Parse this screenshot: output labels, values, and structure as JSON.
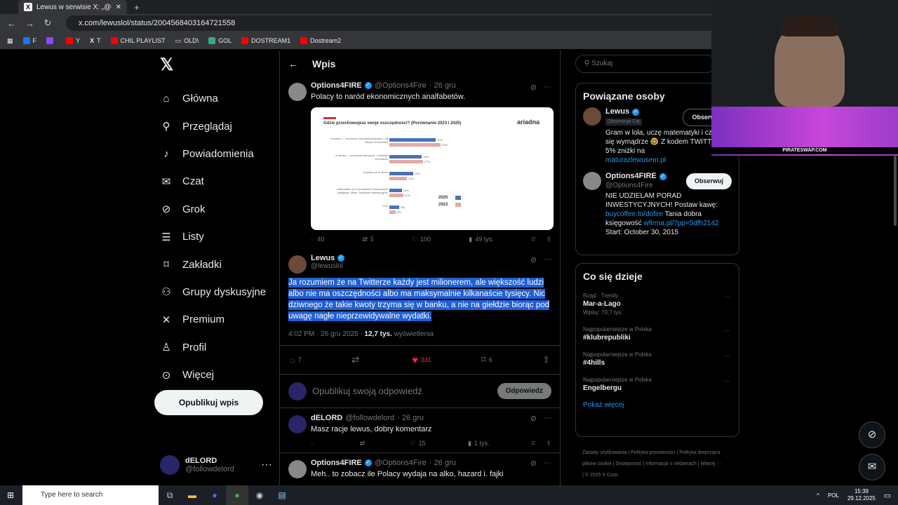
{
  "browser": {
    "tab_title": "Lewus w serwisie X: „@Options4...",
    "url": "x.com/lewuslol/status/2004568403164721558",
    "bookmarks": [
      "F",
      "",
      "Y",
      "T",
      "CHIL PLAYLIST",
      "OLD\\",
      "GOL",
      "DOSTREAM1",
      "Dostream2"
    ]
  },
  "sidebar": {
    "items": [
      {
        "label": "Główna",
        "icon": "home-icon",
        "glyph": "⌂"
      },
      {
        "label": "Przeglądaj",
        "icon": "search-icon",
        "glyph": "⚲"
      },
      {
        "label": "Powiadomienia",
        "icon": "bell-icon",
        "glyph": "♪"
      },
      {
        "label": "Czat",
        "icon": "mail-icon",
        "glyph": "✉"
      },
      {
        "label": "Grok",
        "icon": "grok-icon",
        "glyph": "⊘"
      },
      {
        "label": "Listy",
        "icon": "list-icon",
        "glyph": "☰"
      },
      {
        "label": "Zakładki",
        "icon": "bookmark-icon",
        "glyph": "⌑"
      },
      {
        "label": "Grupy dyskusyjne",
        "icon": "people-icon",
        "glyph": "⚇"
      },
      {
        "label": "Premium",
        "icon": "x-icon",
        "glyph": "✕"
      },
      {
        "label": "Profil",
        "icon": "person-icon",
        "glyph": "♙"
      },
      {
        "label": "Więcej",
        "icon": "more-icon",
        "glyph": "⊙"
      }
    ],
    "post_button": "Opublikuj wpis",
    "account": {
      "name": "dELORD",
      "handle": "@followdelord"
    }
  },
  "main": {
    "header": "Wpis",
    "quoted": {
      "name": "Options4FIRE",
      "handle": "@Options4Fire",
      "date": "· 26 gru",
      "text": "Polacy to naród ekonomicznych analfabetów.",
      "replies": "40",
      "reposts": "5",
      "likes": "100",
      "views": "49 tys."
    },
    "main_tweet": {
      "name": "Lewus",
      "handle": "@lewuslol",
      "text": "Ja rozumiem że na Twitterze każdy jest milionerem, ale większość ludzi albo nie ma oszczędności albo ma maksymalnie kilkanaście tysięcy. Nic dziwnego że takie kwoty trzyma się w banku, a nie na giełdzie biorąc pod uwagę nagłe nieprzewidywalne wydatki.",
      "time": "4:02 PM · 26 gru 2025 · ",
      "views": "12,7 tys.",
      "views_label": " wyświetlenia",
      "replies": "7",
      "reposts": "",
      "likes": "331",
      "bookmarks": "6"
    },
    "reply_box": {
      "placeholder": "Opublikuj swoją odpowiedź",
      "button": "Odpowiedz"
    },
    "replies": [
      {
        "name": "dELORD",
        "handle": "@followdelord",
        "date": "· 26 gru",
        "text": "Masz racje lewus, dobry komentarz",
        "replies": "",
        "reposts": "",
        "likes": "15",
        "views": "1 tys."
      },
      {
        "name": "Options4FIRE",
        "handle": "@Options4Fire",
        "date": "· 26 gru",
        "text": "Meh.. to zobacz ile Polacy wydaja na alko, hazard i. fajki",
        "replies": "",
        "reposts": "",
        "likes": "",
        "views": ""
      }
    ]
  },
  "chart_data": {
    "type": "bar",
    "title": "Gdzie przechowujesz swoje oszczędności? (Porównanie 2023 i 2025)",
    "brand": "ariadna",
    "categories": [
      "w banku — na koncie oszczędnościowym / na lokacie terminowej",
      "w banku — na koncie bieżącym, z którego korzystam",
      "trzymam je w domu",
      "ulokowałem je w produktach finansowych (obligacje, akcje, fundusze inwestycyjne)",
      "inne"
    ],
    "series": [
      {
        "name": "2025",
        "color": "#4a72b8",
        "values": [
          37,
          26,
          19,
          10,
          8
        ]
      },
      {
        "name": "2023",
        "color": "#e3a9a5",
        "values": [
          41,
          27,
          14,
          11,
          5
        ]
      }
    ],
    "ylim": [
      0,
      45
    ],
    "legend": "right"
  },
  "right": {
    "search_placeholder": "Szukaj",
    "related_title": "Powiązane osoby",
    "people": [
      {
        "name": "Lewus",
        "badge": "Obserwuje Cię",
        "button": "Obserwujesz",
        "bio": "Gram w lola, uczę matematyki i czasem się wymądrze 🤓 Z kodem TWITTER 5% zniżki na",
        "link": "maturazlewusem.pl"
      },
      {
        "name": "Options4FIRE",
        "handle": "@Options4Fire",
        "button": "Obserwuj",
        "bio1": "NIE UDZIELAM PORAD INWESTYCYJNYCH! Postaw kawę:",
        "link1": "buycoffee.to/dofire",
        "bio2": " Tania dobra księgowość ",
        "link2": "wfirma.pl/?pp=5dfh2142",
        "bio3": "Start: October 30, 2015"
      }
    ],
    "trends_title": "Co się dzieje",
    "trends": [
      {
        "context": "Rząd · Trendy",
        "name": "Mar-a-Lago",
        "count": "Wpisy: 70,7 tys."
      },
      {
        "context": "Najpopularniejsze w Polska",
        "name": "#klubrepubliki",
        "count": ""
      },
      {
        "context": "Najpopularniejsze w Polska",
        "name": "#4hills",
        "count": ""
      },
      {
        "context": "Najpopularniejsze w Polska",
        "name": "Engelbergu",
        "count": ""
      }
    ],
    "show_more": "Pokaż więcej",
    "footer": "Zasady użytkowania | Polityka prywatności | Polityka dotycząca plików cookie | Dostępność | Informacja o reklamach | Więcej ··· | © 2025 X Corp."
  },
  "overlay": {
    "promo": "PIRATESWAP.COM"
  },
  "taskbar": {
    "search": "Type here to search",
    "lang": "POL",
    "time": "15:39",
    "date": "29.12.2025"
  },
  "colors": {
    "accent": "#1d9bf0",
    "like": "#f91880",
    "selection": "#1f5fd6",
    "promo": "#b143d1"
  }
}
